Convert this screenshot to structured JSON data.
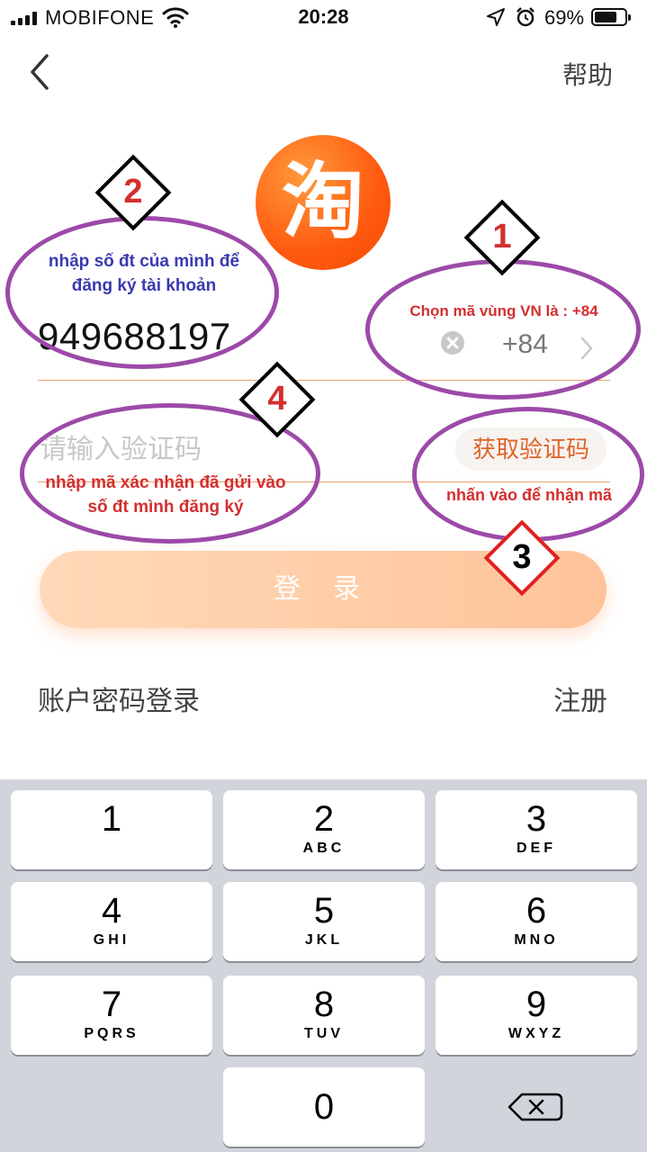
{
  "status_bar": {
    "carrier": "MOBIFONE",
    "time": "20:28",
    "battery": "69%"
  },
  "nav": {
    "back_icon": "chevron-left-icon",
    "help": "帮助"
  },
  "logo": {
    "text": "淘",
    "color": "#ff5a0f"
  },
  "form": {
    "phone_value": "949688197",
    "country_code": "+84",
    "sms_placeholder": "请输入验证码",
    "get_code": "获取验证码",
    "login": "登 录",
    "password_login": "账户密码登录",
    "register": "注册"
  },
  "annotations": [
    {
      "number": "1",
      "text": "Chọn mã vùng VN là : +84",
      "color": "#d32f2f"
    },
    {
      "number": "2",
      "text": "nhập số đt của mình để đăng ký tài khoản",
      "color": "#3a3ab0"
    },
    {
      "number": "3",
      "text": "nhấn vào để nhận mã",
      "color": "#d32f2f"
    },
    {
      "number": "4",
      "text": "nhập mã xác nhận đã gửi vào số đt mình đăng ký",
      "color": "#d32f2f"
    }
  ],
  "keypad": {
    "keys": [
      {
        "digit": "1",
        "letters": ""
      },
      {
        "digit": "2",
        "letters": "ABC"
      },
      {
        "digit": "3",
        "letters": "DEF"
      },
      {
        "digit": "4",
        "letters": "GHI"
      },
      {
        "digit": "5",
        "letters": "JKL"
      },
      {
        "digit": "6",
        "letters": "MNO"
      },
      {
        "digit": "7",
        "letters": "PQRS"
      },
      {
        "digit": "8",
        "letters": "TUV"
      },
      {
        "digit": "9",
        "letters": "WXYZ"
      },
      {
        "digit": "0",
        "letters": ""
      }
    ],
    "delete_icon": "backspace-icon"
  }
}
